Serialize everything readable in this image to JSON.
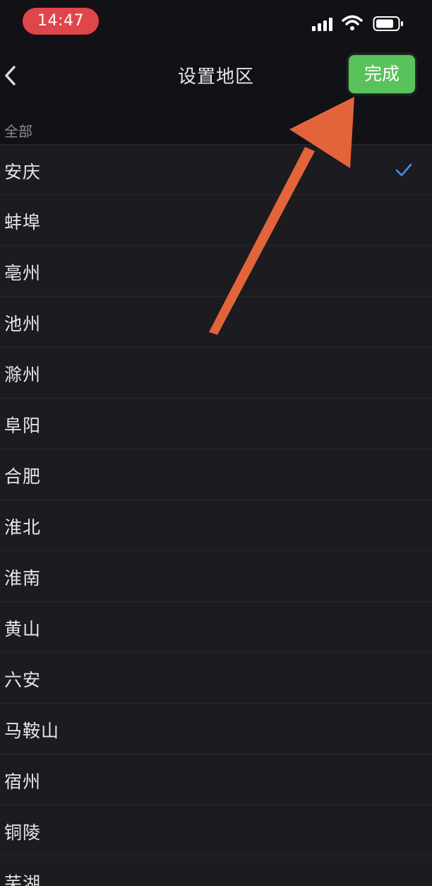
{
  "status_bar": {
    "time": "14:47",
    "time_pill_color": "#e0454a",
    "icons": [
      "signal-icon",
      "wifi-icon",
      "battery-icon"
    ]
  },
  "nav": {
    "back_icon": "chevron-left-icon",
    "title": "设置地区",
    "done_label": "完成",
    "done_color": "#5ac25b"
  },
  "section": {
    "label": "全部"
  },
  "regions": [
    {
      "name": "安庆",
      "selected": true
    },
    {
      "name": "蚌埠",
      "selected": false
    },
    {
      "name": "亳州",
      "selected": false
    },
    {
      "name": "池州",
      "selected": false
    },
    {
      "name": "滁州",
      "selected": false
    },
    {
      "name": "阜阳",
      "selected": false
    },
    {
      "name": "合肥",
      "selected": false
    },
    {
      "name": "淮北",
      "selected": false
    },
    {
      "name": "淮南",
      "selected": false
    },
    {
      "name": "黄山",
      "selected": false
    },
    {
      "name": "六安",
      "selected": false
    },
    {
      "name": "马鞍山",
      "selected": false
    },
    {
      "name": "宿州",
      "selected": false
    },
    {
      "name": "铜陵",
      "selected": false
    },
    {
      "name": "芜湖",
      "selected": false
    }
  ],
  "colors": {
    "background": "#1c1b20",
    "bar": "#121116",
    "check": "#4a8fe0",
    "annotation_arrow": "#e3643a"
  }
}
